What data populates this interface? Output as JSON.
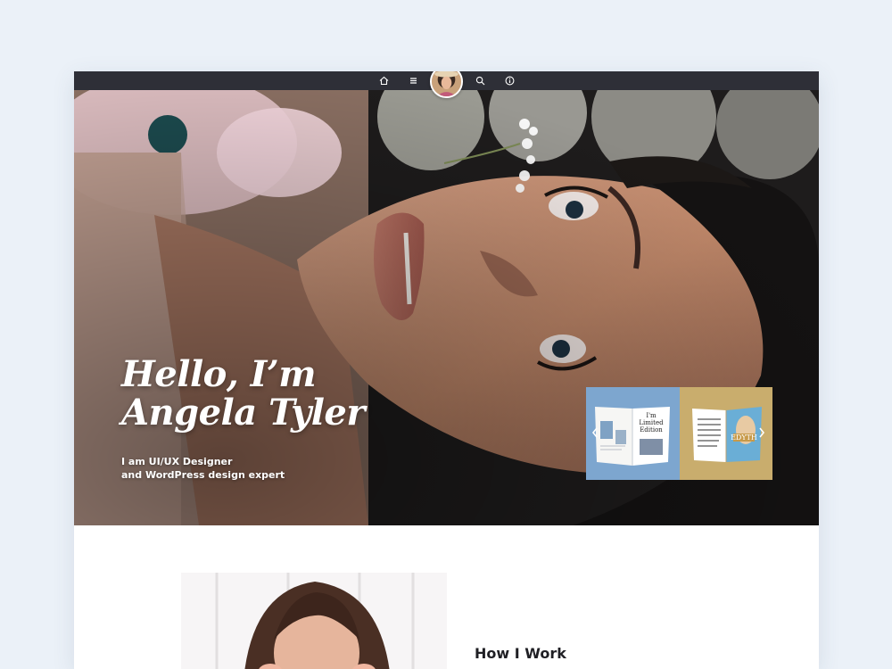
{
  "nav": {
    "icons": [
      "home-icon",
      "menu-icon",
      "search-icon",
      "info-icon"
    ],
    "avatar": "profile-avatar"
  },
  "hero": {
    "heading_line1": "Hello, I’m",
    "heading_line2": "Angela Tyler",
    "subtitle_line1": "I am UI/UX Designer",
    "subtitle_line2": "and WordPress design expert",
    "slider": {
      "cards": [
        {
          "label_line1": "I'm",
          "label_line2": "Limited",
          "label_line3": "Edition"
        },
        {
          "label": "EDYTH"
        }
      ],
      "prev_icon": "chevron-left-icon",
      "next_icon": "chevron-right-icon"
    }
  },
  "about": {
    "section_title": "How I Work"
  },
  "colors": {
    "page_bg": "#ebf1f8",
    "nav_bg": "#2e2f37",
    "card_blue": "#7da6cf",
    "card_gold": "#c9ad6d",
    "text_dark": "#1f1f24"
  }
}
